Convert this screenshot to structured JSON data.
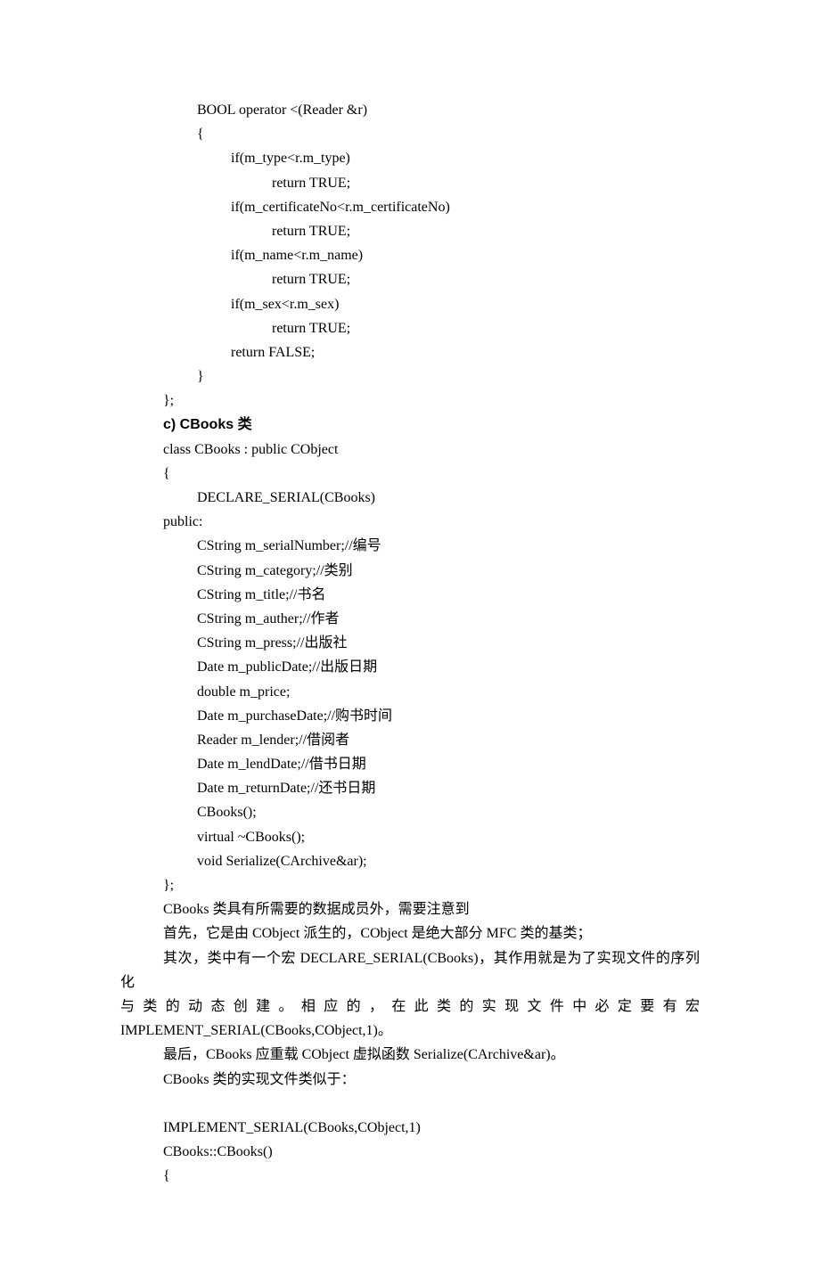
{
  "code1": {
    "l1": "BOOL operator <(Reader &r)",
    "l2": "{",
    "l3": "if(m_type<r.m_type)",
    "l4": "return TRUE;",
    "l5": "if(m_certificateNo<r.m_certificateNo)",
    "l6": "return TRUE;",
    "l7": "if(m_name<r.m_name)",
    "l8": "return TRUE;",
    "l9": "if(m_sex<r.m_sex)",
    "l10": "return TRUE;",
    "l11": "return FALSE;",
    "l12": "}",
    "l13": "};"
  },
  "heading": "c)  CBooks 类",
  "code2": {
    "l1": "class CBooks : public CObject",
    "l2": "{",
    "l3": "DECLARE_SERIAL(CBooks)",
    "l4": "public:",
    "l5": "CString m_serialNumber;//编号",
    "l6": "CString m_category;//类别",
    "l7": "CString m_title;//书名",
    "l8": "CString m_auther;//作者",
    "l9": "CString m_press;//出版社",
    "l10": "Date m_publicDate;//出版日期",
    "l11": "double m_price;",
    "l12": "Date m_purchaseDate;//购书时间",
    "l13": "Reader m_lender;//借阅者",
    "l14": "Date m_lendDate;//借书日期",
    "l15": "Date m_returnDate;//还书日期",
    "l16": "CBooks();",
    "l17": "virtual ~CBooks();",
    "l18": "void Serialize(CArchive&ar);",
    "l19": "};"
  },
  "para": {
    "p1": "CBooks 类具有所需要的数据成员外，需要注意到",
    "p2": "首先，它是由 CObject 派生的，CObject 是绝大部分 MFC 类的基类；",
    "p3a": "其次，类中有一个宏 DECLARE_SERIAL(CBooks)，其作用就是为了实现文件的序列化",
    "p3b": "与类的动态创建。相应的，在此类的实现文件中必定要有宏",
    "p3c": "IMPLEMENT_SERIAL(CBooks,CObject,1)。",
    "p4": "最后，CBooks 应重载 CObject 虚拟函数 Serialize(CArchive&ar)。",
    "p5": "CBooks 类的实现文件类似于："
  },
  "code3": {
    "l1": "IMPLEMENT_SERIAL(CBooks,CObject,1)",
    "l2": "CBooks::CBooks()",
    "l3": "{"
  }
}
